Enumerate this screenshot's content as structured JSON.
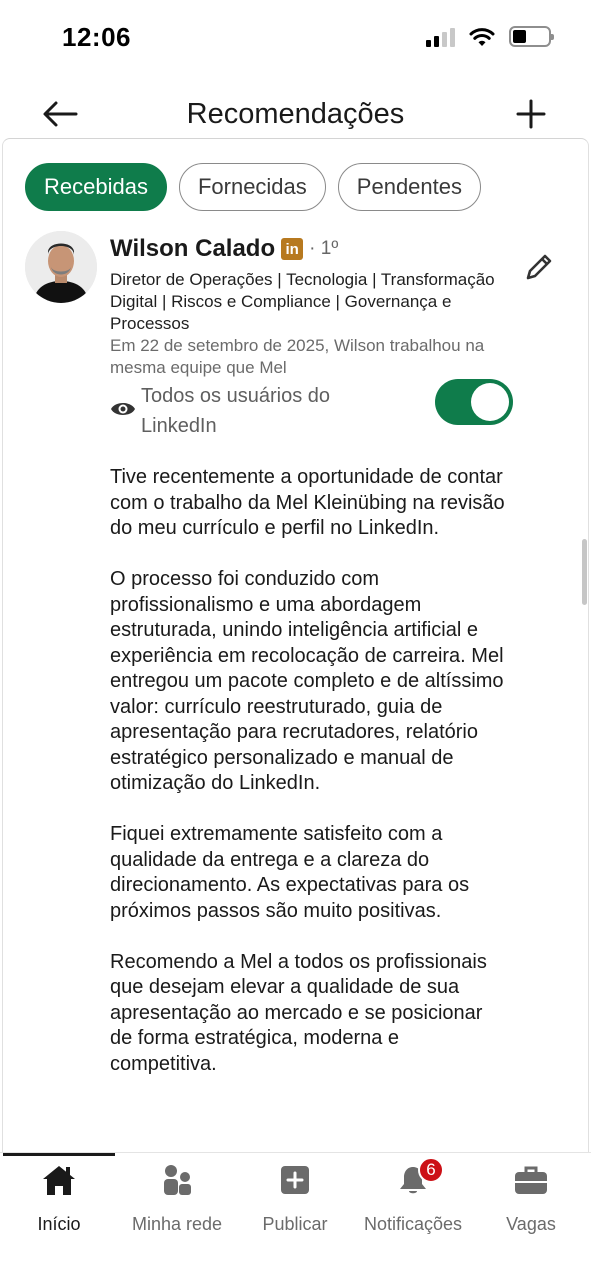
{
  "status_bar": {
    "time": "12:06"
  },
  "header": {
    "title": "Recomendações"
  },
  "tabs": [
    {
      "label": "Recebidas",
      "active": true
    },
    {
      "label": "Fornecidas",
      "active": false
    },
    {
      "label": "Pendentes",
      "active": false
    }
  ],
  "recommendation": {
    "name": "Wilson Calado",
    "linkedin_badge": "in",
    "degree": "· 1º",
    "headline": "Diretor de Operações | Tecnologia | Transformação Digital | Riscos e Compliance | Governança e Processos",
    "context": "Em 22 de setembro de 2025, Wilson trabalhou na mesma equipe que Mel",
    "visibility_label": "Todos os usuários do LinkedIn",
    "visibility_on": true,
    "paragraphs": [
      "Tive recentemente a oportunidade de contar com o trabalho da Mel Kleinübing na revisão do meu currículo e perfil no LinkedIn.",
      "O processo foi conduzido com profissionalismo e uma abordagem estruturada, unindo inteligência artificial e experiência em recolocação de carreira. Mel entregou um pacote completo e de altíssimo valor: currículo reestruturado, guia de apresentação para recrutadores, relatório estratégico personalizado e manual de otimização do LinkedIn.",
      "Fiquei extremamente satisfeito com a qualidade da entrega e a clareza do direcionamento. As expectativas para os próximos passos são muito positivas.",
      "Recomendo a Mel a todos os profissionais que desejam elevar a qualidade de sua apresentação ao mercado e se posicionar de forma estratégica, moderna e competitiva."
    ]
  },
  "bottom_nav": [
    {
      "label": "Início",
      "icon": "home-icon",
      "active": true
    },
    {
      "label": "Minha rede",
      "icon": "network-icon",
      "active": false
    },
    {
      "label": "Publicar",
      "icon": "post-icon",
      "active": false
    },
    {
      "label": "Notificações",
      "icon": "bell-icon",
      "active": false,
      "badge": "6"
    },
    {
      "label": "Vagas",
      "icon": "briefcase-icon",
      "active": false
    }
  ],
  "colors": {
    "accent": "#0f7c4b",
    "badge": "#cc1016",
    "linkedin_badge": "#b7791f"
  }
}
